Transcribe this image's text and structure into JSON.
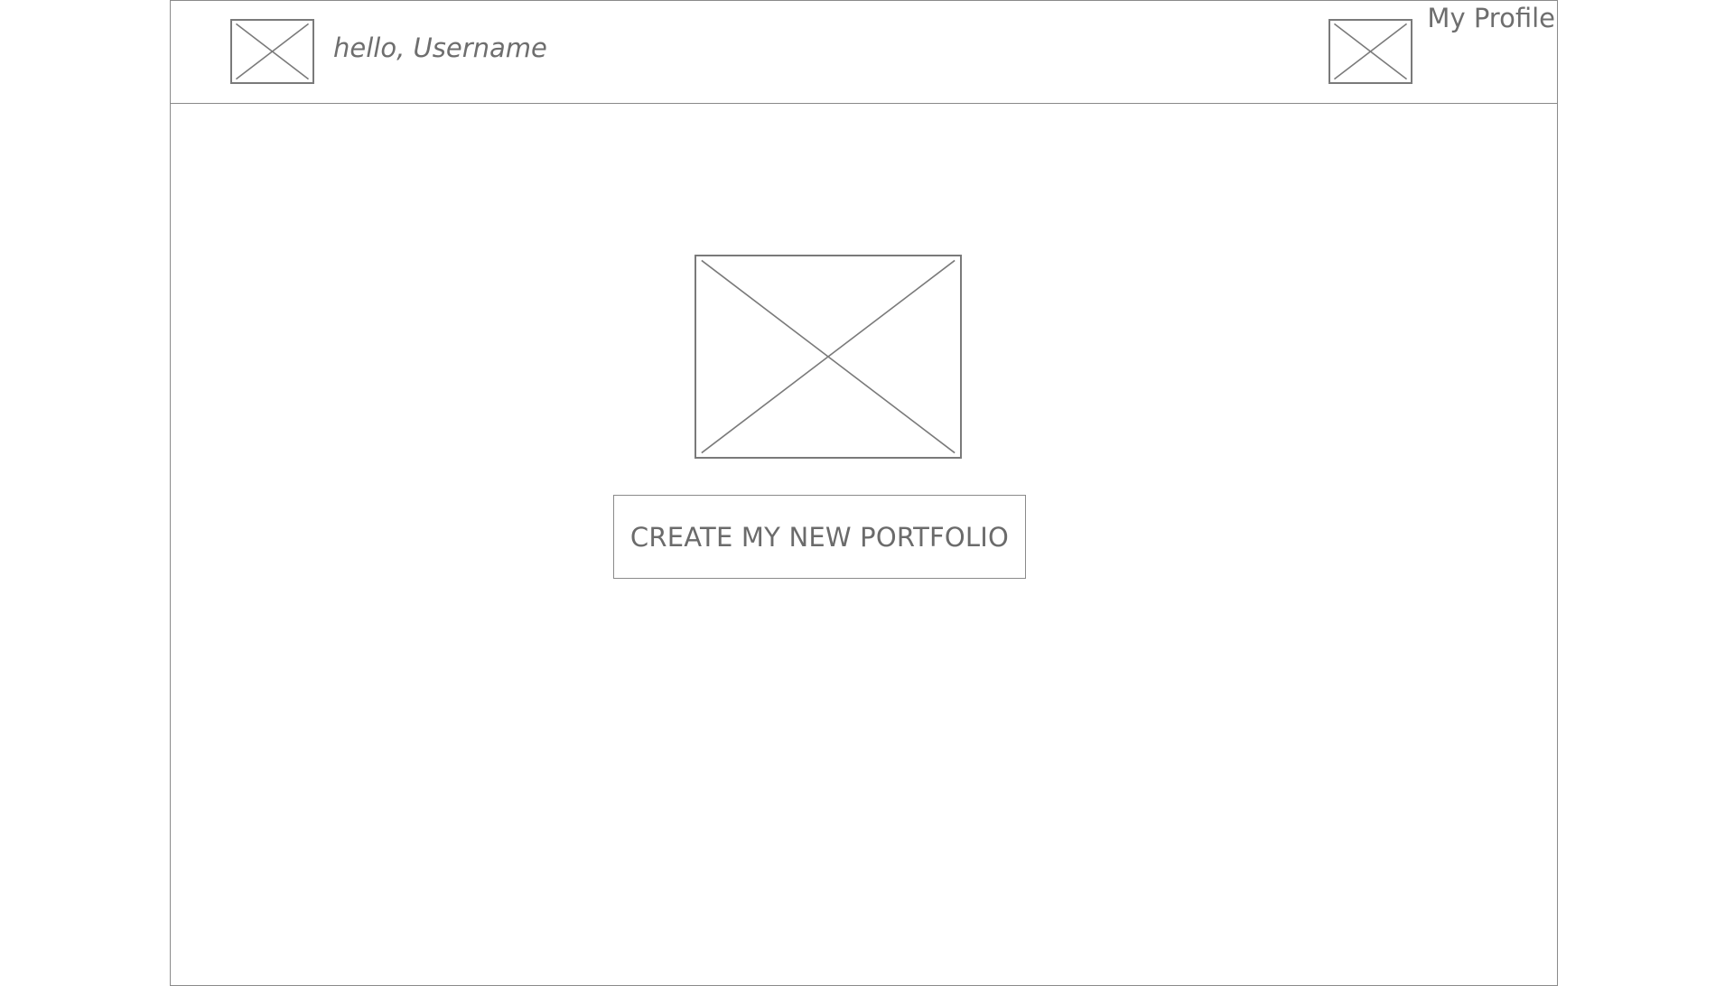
{
  "header": {
    "greeting": "hello, Username",
    "profile_link_label": "My Profile",
    "logo_icon": "image-placeholder-icon",
    "avatar_icon": "image-placeholder-icon"
  },
  "main": {
    "hero_icon": "image-placeholder-icon",
    "create_button_label": "CREATE MY NEW PORTFOLIO"
  },
  "colors": {
    "line": "#8a8a8a",
    "text": "#6b6b6b",
    "background": "#ffffff"
  }
}
